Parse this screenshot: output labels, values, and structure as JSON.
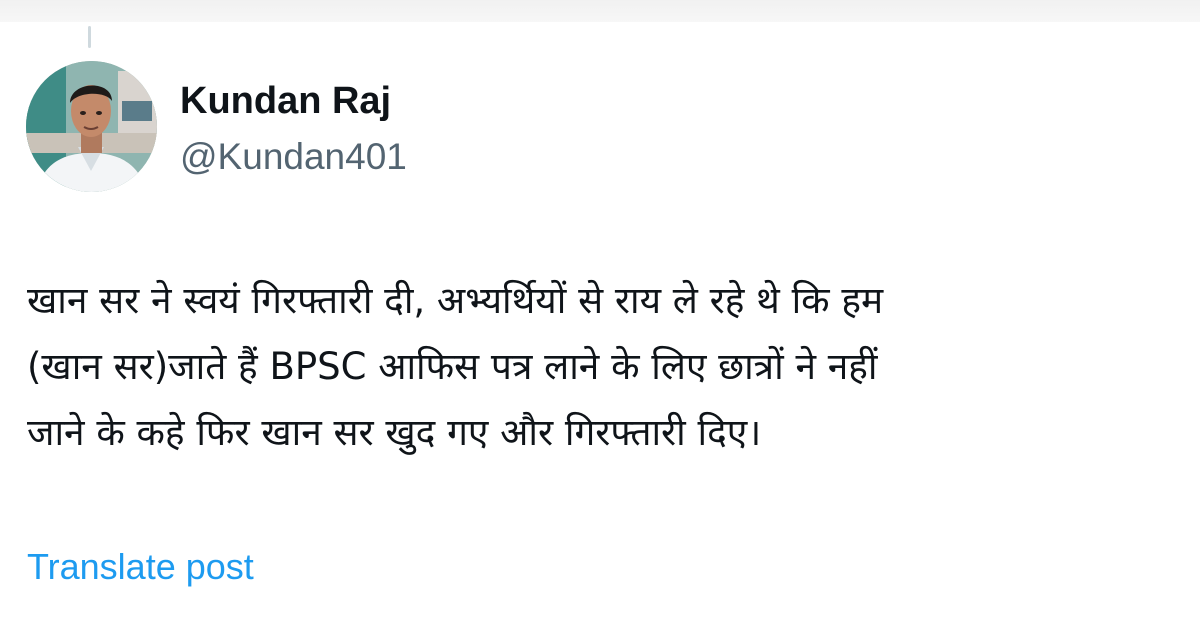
{
  "post": {
    "author": {
      "display_name": "Kundan Raj",
      "handle": "@Kundan401"
    },
    "text_lines": [
      "खान सर ने स्वयं गिरफ्तारी दी, अभ्यर्थियों से राय ले रहे थे कि हम",
      "(खान सर)जाते हैं BPSC आफिस पत्र लाने के लिए छात्रों ने नहीं",
      "जाने के कहे फिर खान सर खुद गए और गिरफ्तारी दिए।"
    ],
    "translate_label": "Translate post"
  },
  "colors": {
    "text": "#0f1419",
    "secondary_text": "#536471",
    "link": "#1d9bf0",
    "background": "#ffffff"
  }
}
